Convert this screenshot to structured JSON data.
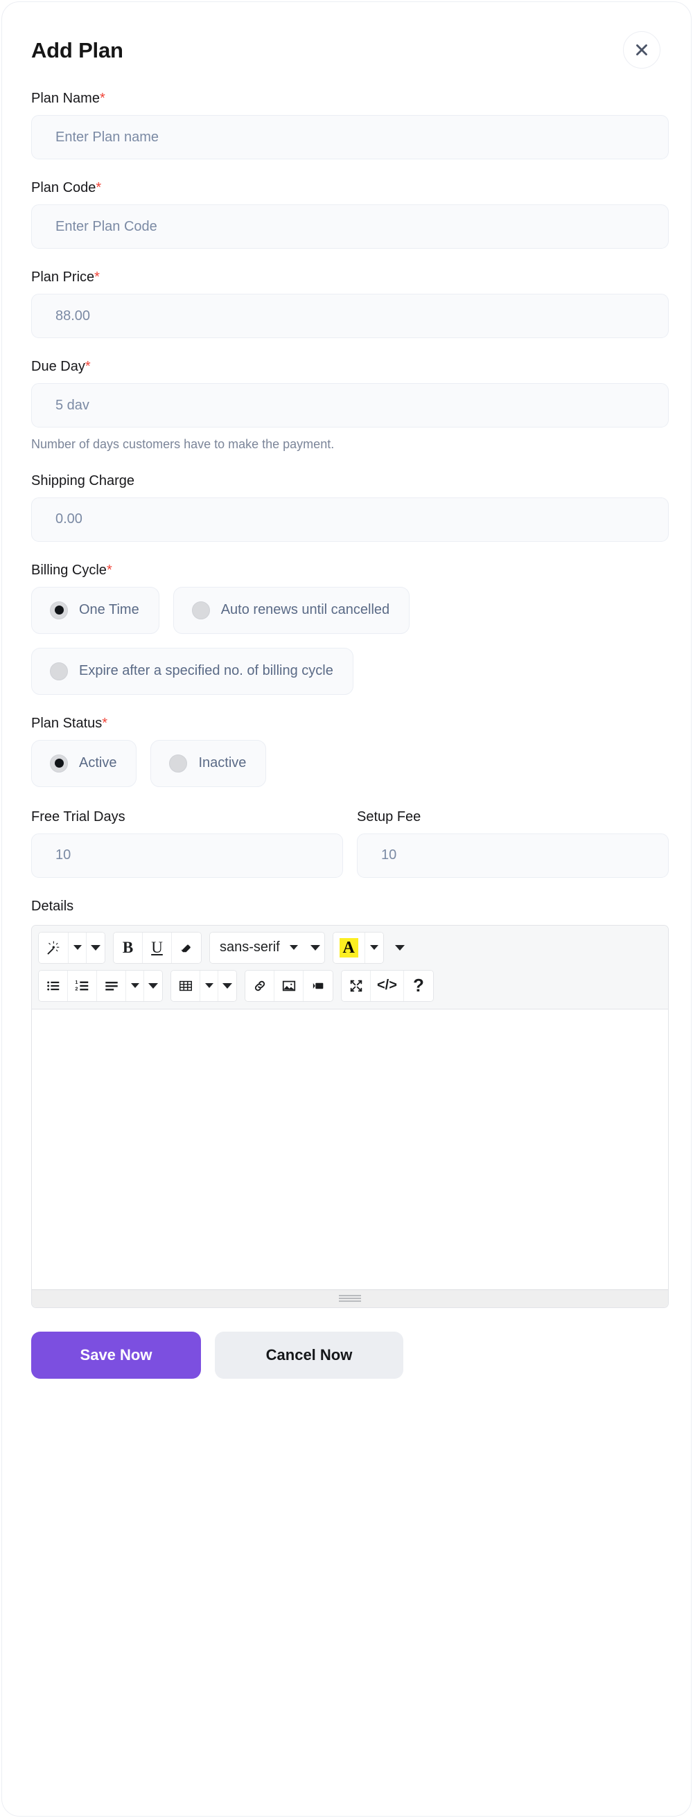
{
  "modal": {
    "title": "Add Plan",
    "close_icon": "close-icon"
  },
  "fields": {
    "plan_name": {
      "label": "Plan Name",
      "required": "*",
      "placeholder": "Enter Plan name",
      "value": ""
    },
    "plan_code": {
      "label": "Plan Code",
      "required": "*",
      "placeholder": "Enter Plan Code",
      "value": ""
    },
    "plan_price": {
      "label": "Plan Price",
      "required": "*",
      "placeholder": "88.00",
      "value": ""
    },
    "due_day": {
      "label": "Due Day",
      "required": "*",
      "placeholder": "5 dav",
      "value": "",
      "helper": "Number of days customers have to make the payment."
    },
    "shipping_charge": {
      "label": "Shipping Charge",
      "required": "",
      "placeholder": "0.00",
      "value": ""
    },
    "free_trial_days": {
      "label": "Free Trial Days",
      "required": "",
      "placeholder": "10",
      "value": ""
    },
    "setup_fee": {
      "label": "Setup Fee",
      "required": "",
      "placeholder": "10",
      "value": ""
    },
    "details": {
      "label": "Details",
      "required": "",
      "content": ""
    }
  },
  "billing_cycle": {
    "label": "Billing Cycle",
    "required": "*",
    "options": [
      {
        "label": "One Time",
        "selected": true
      },
      {
        "label": "Auto renews until cancelled",
        "selected": false
      },
      {
        "label": "Expire after a specified no. of billing cycle",
        "selected": false
      }
    ]
  },
  "plan_status": {
    "label": "Plan Status",
    "required": "*",
    "options": [
      {
        "label": "Active",
        "selected": true
      },
      {
        "label": "Inactive",
        "selected": false
      }
    ]
  },
  "editor": {
    "font_family_value": "sans-serif",
    "toolbar_row1": [
      "magic-wand-icon",
      "bold-icon",
      "underline-icon",
      "eraser-icon",
      "font-family-select",
      "highlight-color-icon"
    ],
    "toolbar_row2": [
      "unordered-list-icon",
      "ordered-list-icon",
      "align-left-icon",
      "table-icon",
      "link-icon",
      "image-icon",
      "video-icon",
      "fullscreen-icon",
      "code-view-icon",
      "help-icon"
    ],
    "resize_handle": "resize-grip-icon"
  },
  "footer": {
    "save_label": "Save Now",
    "cancel_label": "Cancel Now"
  },
  "colors": {
    "primary": "#7c4fe0",
    "secondary": "#eceef2",
    "required_asterisk": "#f04438",
    "input_bg": "#f9fafc",
    "input_border": "#ebeef4",
    "text": "#17171a",
    "muted_text": "#5d6b86",
    "highlight_yellow": "#fcee21"
  }
}
